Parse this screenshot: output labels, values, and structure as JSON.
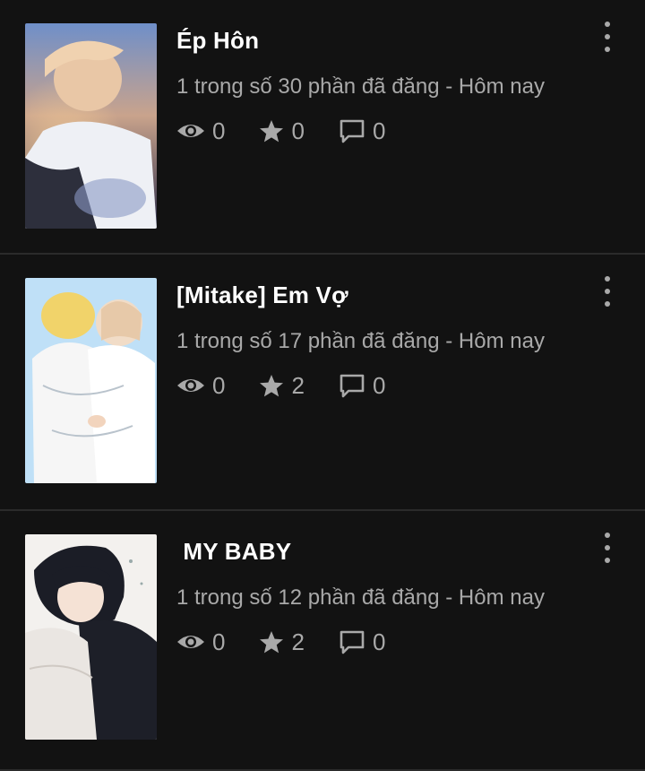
{
  "stories": [
    {
      "title": "Ép Hôn",
      "meta": "1 trong số 30 phần đã đăng - Hôm nay",
      "views": "0",
      "votes": "0",
      "comments": "0",
      "cover_icon": "cover-image"
    },
    {
      "title": "[Mitake] Em Vợ",
      "meta": "1 trong số 17 phần đã đăng - Hôm nay",
      "views": "0",
      "votes": "2",
      "comments": "0",
      "cover_icon": "cover-image"
    },
    {
      "title": " MY BABY",
      "meta": "1 trong số 12 phần đã đăng - Hôm nay",
      "views": "0",
      "votes": "2",
      "comments": "0",
      "cover_icon": "cover-image"
    }
  ],
  "icons": {
    "views": "eye-icon",
    "votes": "star-icon",
    "comments": "comment-icon",
    "menu": "more-vertical-icon"
  },
  "colors": {
    "background": "#121212",
    "title": "#ffffff",
    "secondary": "#a9a9a9",
    "divider": "#2b2b2b"
  }
}
